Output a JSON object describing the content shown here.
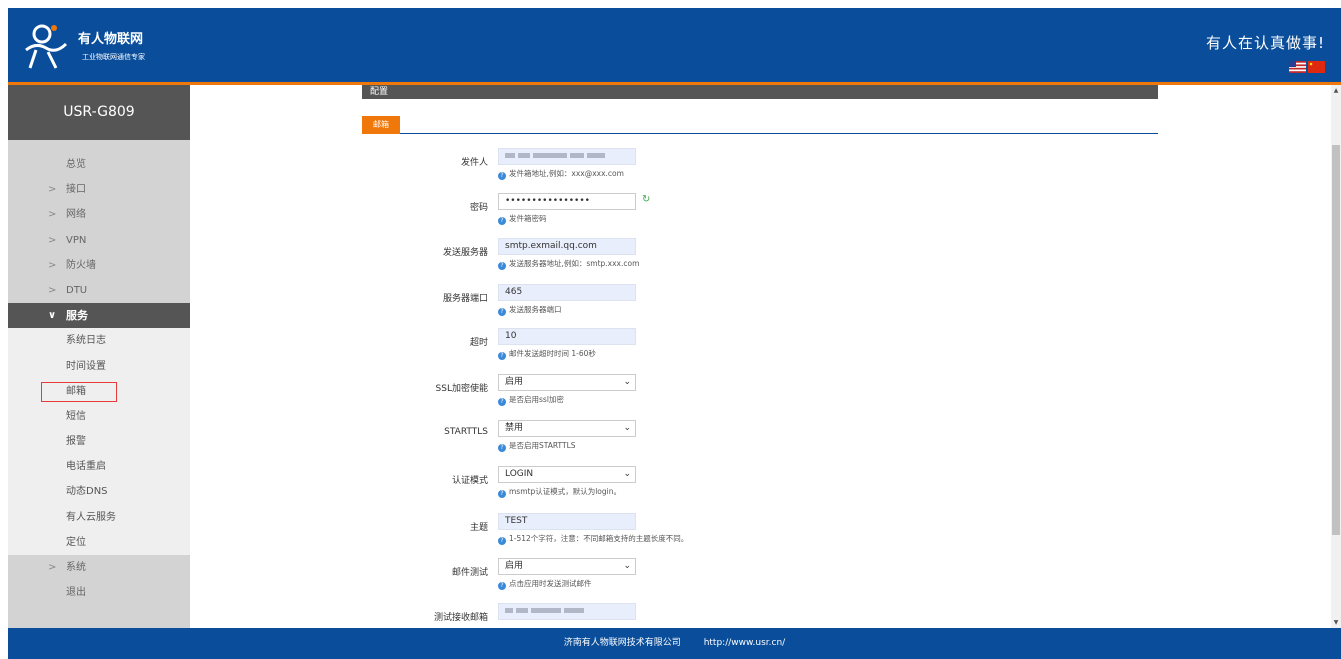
{
  "header": {
    "brand_name": "有人物联网",
    "brand_sub": "工业物联网通信专家",
    "slogan": "有人在认真做事!"
  },
  "sidebar": {
    "device": "USR-G809",
    "items": [
      {
        "label": "总览"
      },
      {
        "label": "接口"
      },
      {
        "label": "网络"
      },
      {
        "label": "VPN"
      },
      {
        "label": "防火墙"
      },
      {
        "label": "DTU"
      },
      {
        "label": "服务"
      },
      {
        "label": "系统日志"
      },
      {
        "label": "时间设置"
      },
      {
        "label": "邮箱"
      },
      {
        "label": "短信"
      },
      {
        "label": "报警"
      },
      {
        "label": "电话重启"
      },
      {
        "label": "动态DNS"
      },
      {
        "label": "有人云服务"
      },
      {
        "label": "定位"
      },
      {
        "label": "系统"
      },
      {
        "label": "退出"
      }
    ]
  },
  "main": {
    "section_title": "配置",
    "tab_label": "邮箱",
    "fields": [
      {
        "label": "发件人",
        "value": "",
        "help": "发件箱地址,例如：xxx@xxx.com"
      },
      {
        "label": "密码",
        "value": "••••••••••••••••",
        "help": "发件箱密码"
      },
      {
        "label": "发送服务器",
        "value": "smtp.exmail.qq.com",
        "help": "发送服务器地址,例如：smtp.xxx.com"
      },
      {
        "label": "服务器端口",
        "value": "465",
        "help": "发送服务器端口"
      },
      {
        "label": "超时",
        "value": "10",
        "help": "邮件发送超时时间 1-60秒"
      },
      {
        "label": "SSL加密使能",
        "value": "启用",
        "help": "是否启用ssl加密"
      },
      {
        "label": "STARTTLS",
        "value": "禁用",
        "help": "是否启用STARTTLS"
      },
      {
        "label": "认证模式",
        "value": "LOGIN",
        "help": "msmtp认证模式，默认为login。"
      },
      {
        "label": "主题",
        "value": "TEST",
        "help": "1-512个字符，注意：不同邮箱支持的主题长度不同。"
      },
      {
        "label": "邮件测试",
        "value": "启用",
        "help": "点击应用时发送测试邮件"
      },
      {
        "label": "测试接收邮箱",
        "value": "",
        "help": ""
      }
    ]
  },
  "footer": {
    "company": "济南有人物联网技术有限公司",
    "url": "http://www.usr.cn/"
  }
}
